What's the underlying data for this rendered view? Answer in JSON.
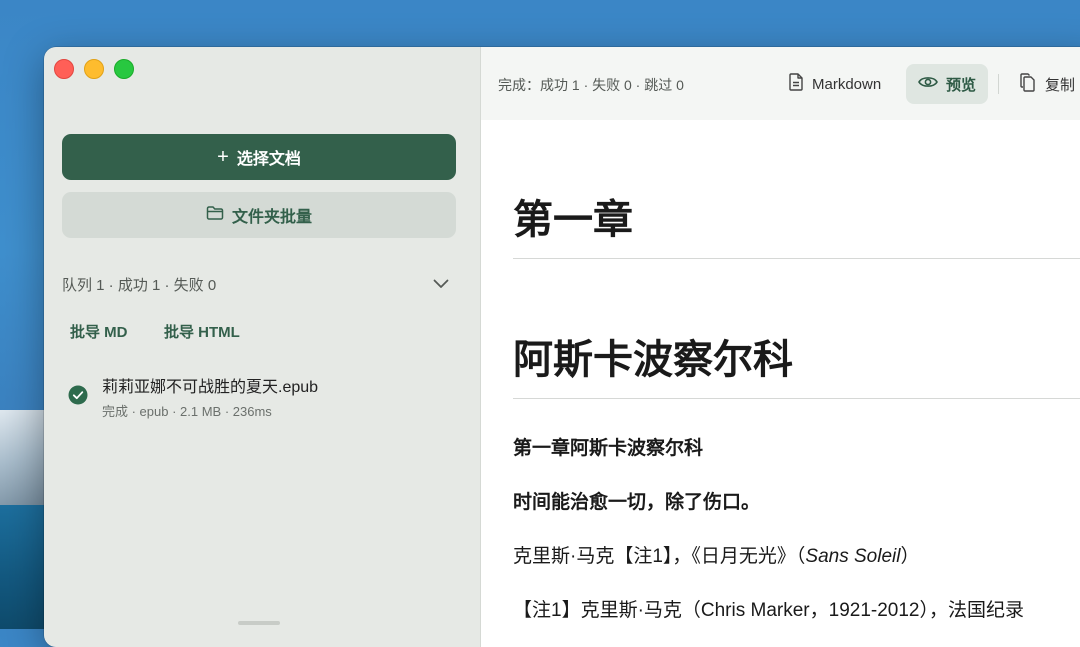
{
  "sidebar": {
    "select_button": "选择文档",
    "folder_button": "文件夹批量",
    "queue_summary": "队列 1 · 成功 1 · 失败 0",
    "batch_md": "批导 MD",
    "batch_html": "批导 HTML",
    "files": [
      {
        "name": "莉莉亚娜不可战胜的夏天.epub",
        "meta": "完成 · epub · 2.1 MB · 236ms",
        "status": "success"
      }
    ]
  },
  "toolbar": {
    "status": "完成：成功 1 · 失败 0 · 跳过 0",
    "markdown_label": "Markdown",
    "preview_label": "预览",
    "copy_label": "复制"
  },
  "document": {
    "heading1": "第一章",
    "heading2": "阿斯卡波察尔科",
    "para1": "第一章阿斯卡波察尔科",
    "para2": "时间能治愈一切，除了伤口。",
    "para3_prefix": "克里斯·马克【注1】，《日月无光》（",
    "para3_italic": "Sans Soleil",
    "para3_suffix": "）",
    "para4": "【注1】克里斯·马克（Chris Marker，1921-2012），法国纪录"
  },
  "colors": {
    "accent": "#33604b",
    "success": "#2e6b4d",
    "close": "#ff5f57",
    "minimize": "#febc2e",
    "zoom": "#28c840"
  },
  "icons": [
    "plus-icon",
    "folder-icon",
    "chevron-down-icon",
    "check-circle-icon",
    "document-icon",
    "eye-icon",
    "copy-icon"
  ]
}
